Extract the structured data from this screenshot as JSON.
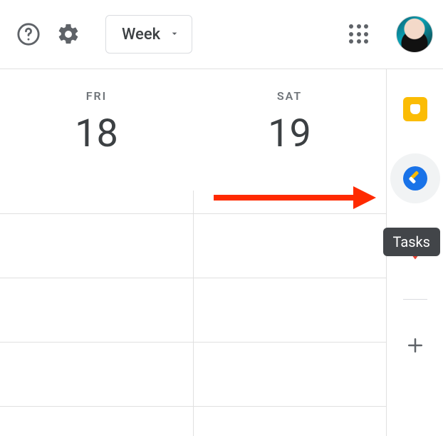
{
  "toolbar": {
    "view_label": "Week"
  },
  "days": [
    {
      "abbr": "FRI",
      "num": "18"
    },
    {
      "abbr": "SAT",
      "num": "19"
    }
  ],
  "side_panel": {
    "tooltip": "Tasks"
  },
  "icons": {
    "help": "help-icon",
    "settings": "gear-icon",
    "apps": "apps-grid-icon",
    "keep": "keep-icon",
    "tasks": "tasks-icon",
    "maps": "maps-icon",
    "add": "plus-icon"
  }
}
